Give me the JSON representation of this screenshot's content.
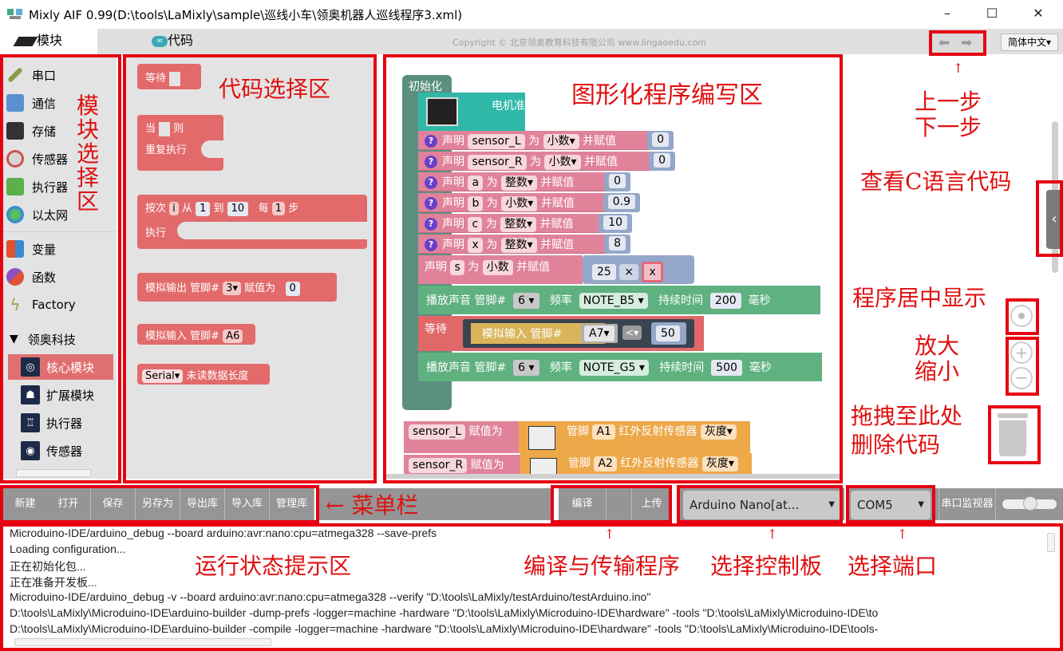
{
  "window": {
    "title": "Mixly AIF 0.99(D:\\tools\\LaMixly\\sample\\巡线小车\\领奥机器人巡线程序3.xml)",
    "minimize": "–",
    "maximize": "☐",
    "close": "✕"
  },
  "tabs": [
    {
      "label": "模块",
      "icon": "chip-icon",
      "active": true
    },
    {
      "label": "代码",
      "icon": "arduino-icon",
      "active": false
    }
  ],
  "copyright": "Copyright © 北京领奥教育科技有限公司 www.lingaoedu.com",
  "undo_redo": {
    "undo": "undo-icon",
    "redo": "redo-icon"
  },
  "language": {
    "selected": "简体中文▾"
  },
  "toolbox": {
    "items": [
      {
        "label": "串口",
        "icon": "usb-cable-icon",
        "color": "#8a9a4a"
      },
      {
        "label": "通信",
        "icon": "communication-icon",
        "color": "#5a8fd0"
      },
      {
        "label": "存储",
        "icon": "storage-icon",
        "color": "#333333"
      },
      {
        "label": "传感器",
        "icon": "sensor-icon",
        "color": "#d05050"
      },
      {
        "label": "执行器",
        "icon": "actuator-icon",
        "color": "#5ab04a"
      },
      {
        "label": "以太网",
        "icon": "globe-icon",
        "color": "#3a8ad0"
      },
      {
        "label": "变量",
        "icon": "variable-icon",
        "color": "#e05030"
      },
      {
        "label": "函数",
        "icon": "function-icon",
        "color": "#9050c0"
      },
      {
        "label": "Factory",
        "icon": "lightning-icon",
        "color": "#a0a050"
      }
    ],
    "category": {
      "label": "领奥科技",
      "expanded": true
    },
    "subitems": [
      {
        "label": "核心模块",
        "icon": "core-module-icon",
        "selected": true
      },
      {
        "label": "扩展模块",
        "icon": "expansion-module-icon",
        "selected": false
      },
      {
        "label": "执行器",
        "icon": "robot-actuator-icon",
        "selected": false
      },
      {
        "label": "传感器",
        "icon": "eye-sensor-icon",
        "selected": false
      }
    ]
  },
  "flyout": {
    "wait": "等待",
    "while_when": "当",
    "while_then": "则",
    "while_repeat": "重复执行",
    "for_label": "按次",
    "for_var": "i",
    "for_from": "从",
    "for_from_val": "1",
    "for_to": "到",
    "for_to_val": "10",
    "for_step": "每",
    "for_step_val": "1",
    "for_step_unit": "步",
    "for_do": "执行",
    "analog_out": "模拟输出 管脚#",
    "analog_out_pin": "3▾",
    "analog_out_assign": "赋值为",
    "analog_out_val": "0",
    "analog_in": "模拟输入 管脚#",
    "analog_in_pin": "A6",
    "serial": "Serial▾",
    "serial_avail": "未读数据长度"
  },
  "workspace": {
    "setup": "初始化",
    "motor": "电机准备",
    "declares": [
      {
        "name": "sensor_L",
        "type": "小数",
        "value": "0"
      },
      {
        "name": "sensor_R",
        "type": "小数",
        "value": "0"
      },
      {
        "name": "a",
        "type": "整数",
        "value": "0"
      },
      {
        "name": "b",
        "type": "小数",
        "value": "0.9"
      },
      {
        "name": "c",
        "type": "整数",
        "value": "10"
      },
      {
        "name": "x",
        "type": "整数",
        "value": "8"
      }
    ],
    "declare_word": "声明",
    "as_word": "为",
    "assign_word": "并赋值",
    "help": "?",
    "s_decl": {
      "name": "s",
      "type": "小数",
      "left": "25",
      "op": "×",
      "right": "x"
    },
    "tone1": {
      "label": "播放声音 管脚#",
      "pin": "6",
      "freq_label": "频率",
      "freq": "NOTE_B5",
      "dur_label": "持续时间",
      "dur": "200",
      "unit": "毫秒"
    },
    "wait": {
      "label": "等待",
      "analog": "模拟输入 管脚#",
      "pin": "A7",
      "op": "<",
      "value": "50"
    },
    "tone2": {
      "label": "播放声音 管脚#",
      "pin": "6",
      "freq_label": "频率",
      "freq": "NOTE_G5",
      "dur_label": "持续时间",
      "dur": "500",
      "unit": "毫秒"
    },
    "assign_L": {
      "var": "sensor_L",
      "assign": "赋值为",
      "pin_label": "管脚",
      "pin": "A1",
      "sensor": "红外反射传感器",
      "mode": "灰度"
    },
    "assign_R": {
      "var": "sensor_R",
      "assign": "赋值为",
      "pin_label": "管脚",
      "pin": "A2",
      "sensor": "红外反射传感器",
      "mode": "灰度"
    }
  },
  "menubar": {
    "buttons": [
      "新建",
      "打开",
      "保存",
      "另存为",
      "导出库",
      "导入库",
      "管理库"
    ],
    "compile": "编译",
    "upload": "上传",
    "board": "Arduino Nano[at...",
    "port": "COM5",
    "serial_monitor": "串口监视器"
  },
  "console": {
    "lines": [
      "Microduino-IDE/arduino_debug --board arduino:avr:nano:cpu=atmega328 --save-prefs",
      "Loading configuration...",
      "正在初始化包...",
      "正在准备开发板...",
      "Microduino-IDE/arduino_debug -v --board arduino:avr:nano:cpu=atmega328 --verify \"D:\\tools\\LaMixly/testArduino/testArduino.ino\"",
      "D:\\tools\\LaMixly\\Microduino-IDE\\arduino-builder -dump-prefs -logger=machine -hardware \"D:\\tools\\LaMixly\\Microduino-IDE\\hardware\" -tools \"D:\\tools\\LaMixly\\Microduino-IDE\\to",
      "D:\\tools\\LaMixly\\Microduino-IDE\\arduino-builder -compile -logger=machine -hardware \"D:\\tools\\LaMixly\\Microduino-IDE\\hardware\" -tools \"D:\\tools\\LaMixly\\Microduino-IDE\\tools-"
    ]
  },
  "annotations": {
    "toolbox": "模块选择区",
    "flyout": "代码选择区",
    "workspace": "图形化程序编写区",
    "undo_redo_1": "上一步",
    "undo_redo_2": "下一步",
    "view_c": "查看C语言代码",
    "center": "程序居中显示",
    "zoom_in": "放大",
    "zoom_out": "缩小",
    "trash_1": "拖拽至此处",
    "trash_2": "删除代码",
    "menubar": "← 菜单栏",
    "console": "运行状态提示区",
    "compile": "编译与传输程序",
    "board": "选择控制板",
    "port": "选择端口"
  },
  "colors": {
    "annotation": "#e60012",
    "selected_item": "#e07070"
  }
}
